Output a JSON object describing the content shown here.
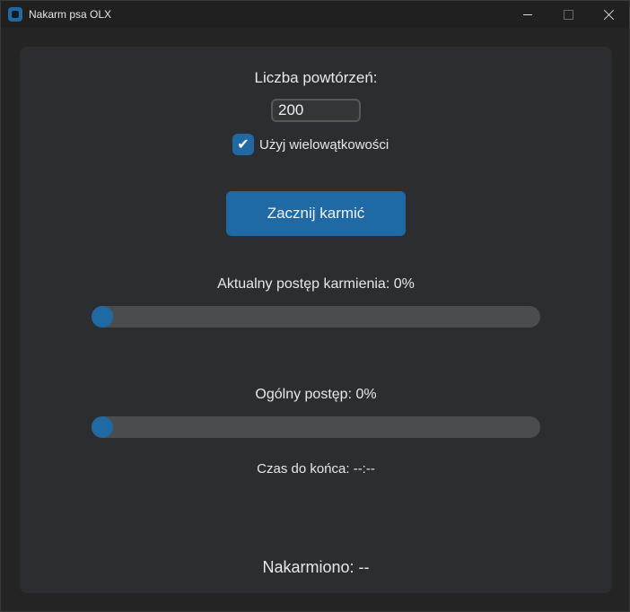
{
  "window": {
    "title": "Nakarm psa OLX",
    "icon": "app-icon",
    "accent": "#1f6aa5"
  },
  "form": {
    "count_label": "Liczba powtórzeń:",
    "count_value": "200",
    "multithread_label": "Użyj wielowątkowości",
    "multithread_checked": true,
    "start_button_label": "Zacznij karmić"
  },
  "progress": {
    "current_label": "Aktualny postęp karmienia: 0%",
    "current_fraction": 0,
    "overall_label": "Ogólny postęp: 0%",
    "overall_fraction": 0
  },
  "status": {
    "time_remaining_label": "Czas do końca: --:--",
    "fed_label": "Nakarmiono: --"
  }
}
